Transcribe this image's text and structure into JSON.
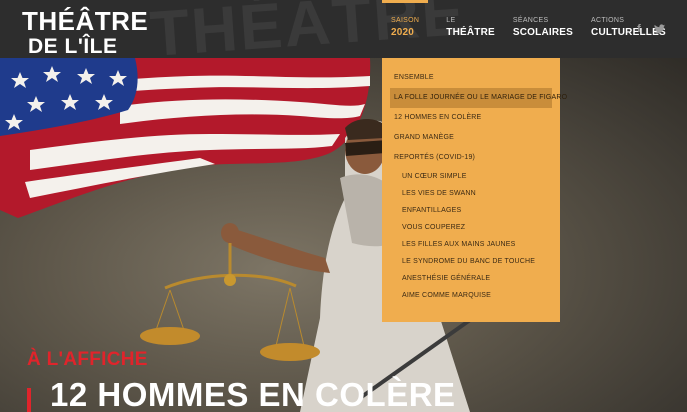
{
  "brand": {
    "logo_line1": "THÉÂTRE",
    "logo_line2": "DE L'ÎLE",
    "watermark": "THÉÂTRE",
    "accent_color": "#f0ad4e",
    "red_color": "#e0242b"
  },
  "nav": {
    "items": [
      {
        "small": "SAISON",
        "big": "2020",
        "active": true
      },
      {
        "small": "LE",
        "big": "THÉÂTRE",
        "active": false
      },
      {
        "small": "SÉANCES",
        "big": "SCOLAIRES",
        "active": false
      },
      {
        "small": "ACTIONS",
        "big": "CULTURELLES",
        "active": false
      }
    ]
  },
  "social": {
    "facebook": "f",
    "twitter": "twitter-icon"
  },
  "dropdown": {
    "items": [
      {
        "label": "ENSEMBLE",
        "level": 0
      },
      {
        "label": "LA FOLLE JOURNÉE OU LE MARIAGE DE FIGARO",
        "level": 0,
        "selected": true
      },
      {
        "label": "12 HOMMES EN COLÈRE",
        "level": 0
      },
      {
        "label": "GRAND MANÈGE",
        "level": 0
      },
      {
        "label": "REPORTÉS (COVID-19)",
        "level": 0
      },
      {
        "label": "UN CŒUR SIMPLE",
        "level": 1
      },
      {
        "label": "LES VIES DE SWANN",
        "level": 1
      },
      {
        "label": "ENFANTILLAGES",
        "level": 1
      },
      {
        "label": "VOUS COUPEREZ",
        "level": 1
      },
      {
        "label": "LES FILLES AUX MAINS JAUNES",
        "level": 1
      },
      {
        "label": "LE SYNDROME DU BANC DE TOUCHE",
        "level": 1
      },
      {
        "label": "ANESTHÉSIE GÉNÉRALE",
        "level": 1
      },
      {
        "label": "AIME COMME MARQUISE",
        "level": 1
      }
    ]
  },
  "hero": {
    "tagline": "À L'AFFICHE",
    "title": "12 HOMMES EN COLÈRE"
  }
}
